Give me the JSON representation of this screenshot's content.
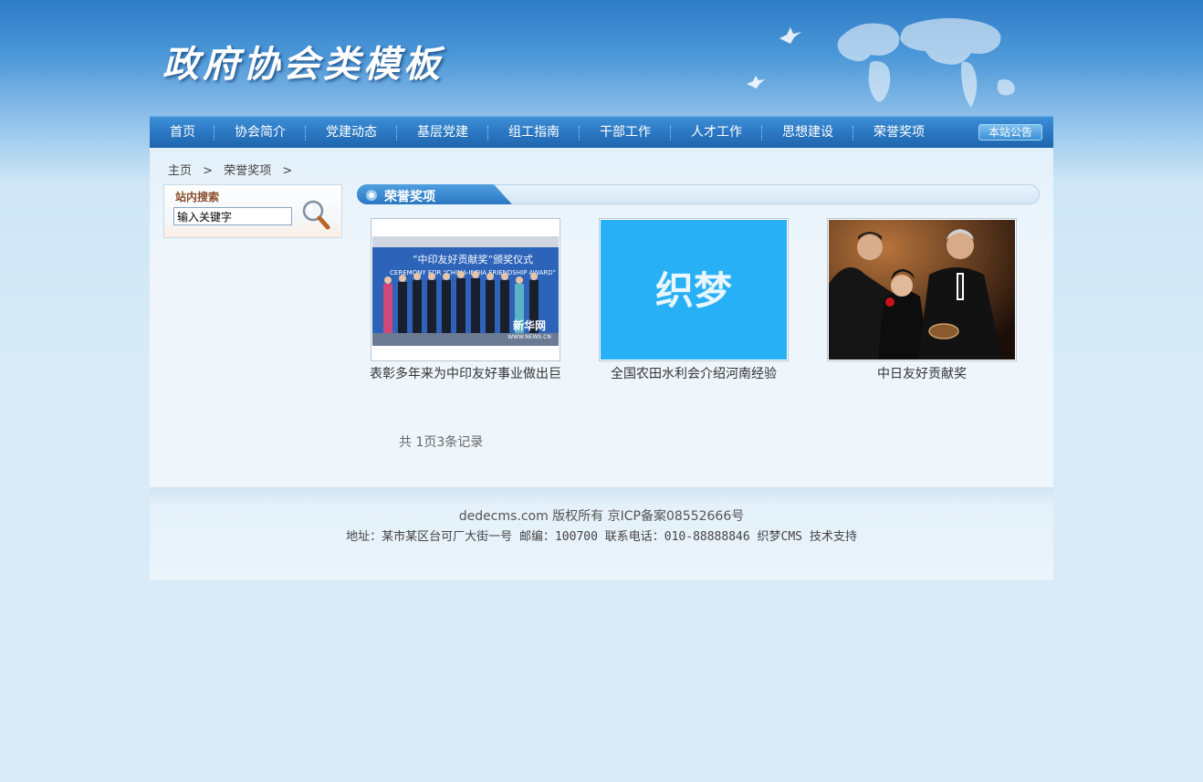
{
  "header": {
    "logo_text": "政府协会类模板"
  },
  "nav": {
    "items": [
      "首页",
      "协会简介",
      "党建动态",
      "基层党建",
      "组工指南",
      "干部工作",
      "人才工作",
      "思想建设",
      "荣誉奖项"
    ],
    "notice_label": "本站公告"
  },
  "breadcrumb": {
    "home": "主页",
    "separator": ">",
    "current": "荣誉奖项"
  },
  "search": {
    "title": "站内搜索",
    "input_value": "输入关键字"
  },
  "section": {
    "title": "荣誉奖项"
  },
  "items": [
    {
      "caption": "表彰多年来为中印友好事业做出巨",
      "image_banner": "“中印友好贡献奖”颁奖仪式",
      "image_banner_en": "CEREMONY FOR “CHINA-INDIA FRIENDSHIP AWARD”",
      "watermark": "新华网",
      "watermark_url": "WWW.NEWS.CN"
    },
    {
      "caption": "全国农田水利会介绍河南经验",
      "image_text": "织梦"
    },
    {
      "caption": "中日友好贡献奖"
    }
  ],
  "pagination": {
    "text": "共 1页3条记录"
  },
  "footer": {
    "line1": "dedecms.com 版权所有 京ICP备案08552666号",
    "line2": "地址：某市某区台可厂大街一号  邮编：100700  联系电话：010-88888846 织梦CMS 技术支持"
  },
  "colors": {
    "nav_bg": "#2b78c2",
    "logo_image_bg": "#27b0f5",
    "content_bg": "#eef6fc"
  }
}
